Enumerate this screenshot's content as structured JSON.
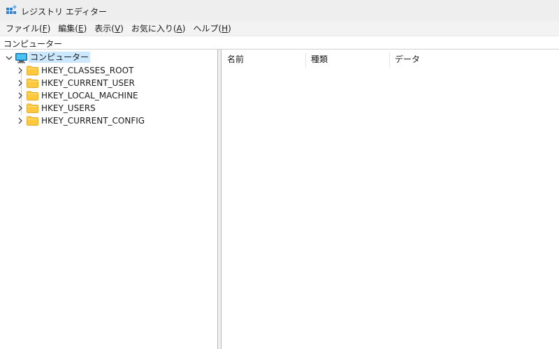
{
  "window": {
    "title": "レジストリ エディター",
    "app_icon": "registry-editor-icon"
  },
  "menu": [
    {
      "label": "ファイル(",
      "key": "F",
      "suffix": ")"
    },
    {
      "label": "編集(",
      "key": "E",
      "suffix": ")"
    },
    {
      "label": "表示(",
      "key": "V",
      "suffix": ")"
    },
    {
      "label": "お気に入り(",
      "key": "A",
      "suffix": ")"
    },
    {
      "label": "ヘルプ(",
      "key": "H",
      "suffix": ")"
    }
  ],
  "address": {
    "path": "コンピューター"
  },
  "tree": {
    "root": {
      "label": "コンピューター",
      "icon": "computer-icon",
      "expanded": true
    },
    "children": [
      {
        "label": "HKEY_CLASSES_ROOT",
        "icon": "folder-icon"
      },
      {
        "label": "HKEY_CURRENT_USER",
        "icon": "folder-icon"
      },
      {
        "label": "HKEY_LOCAL_MACHINE",
        "icon": "folder-icon"
      },
      {
        "label": "HKEY_USERS",
        "icon": "folder-icon"
      },
      {
        "label": "HKEY_CURRENT_CONFIG",
        "icon": "folder-icon"
      }
    ]
  },
  "list": {
    "columns": [
      "名前",
      "種類",
      "データ"
    ]
  },
  "colors": {
    "titlebar_bg": "#eeeeee",
    "menubar_bg": "#f3f3f3",
    "selection_bg": "#cce8ff",
    "folder_yellow": "#ffc83d",
    "folder_yellow_dark": "#e8a92a"
  }
}
